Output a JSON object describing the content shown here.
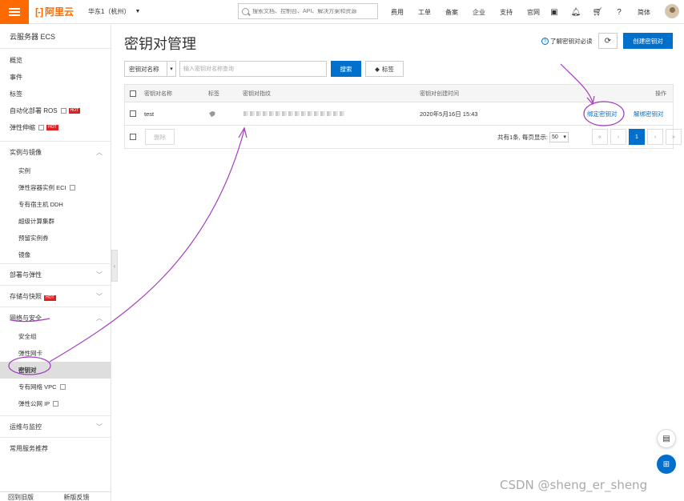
{
  "topbar": {
    "brand": "阿里云",
    "region": "华东1（杭州）",
    "search_placeholder": "搜索文档、控制台、API、解决方案和资源",
    "nav": [
      "费用",
      "工单",
      "备案",
      "企业",
      "支持",
      "官网"
    ],
    "lang": "简体"
  },
  "sidebar": {
    "title": "云服务器 ECS",
    "top_items": [
      "概览",
      "事件",
      "标签",
      "自动化部署 ROS",
      "弹性伸缩"
    ],
    "hot_label": "HOT",
    "groups": {
      "instances": {
        "label": "实例与镜像",
        "items": [
          "实例",
          "弹性容器实例 ECI",
          "专有宿主机 DDH",
          "超级计算集群",
          "预留实例券",
          "镜像"
        ]
      },
      "deploy": "部署与弹性",
      "storage": "存储与快照",
      "network": {
        "label": "网络与安全",
        "items": [
          "安全组",
          "弹性网卡",
          "密钥对",
          "专有网络 VPC",
          "弹性公网 IP"
        ]
      },
      "ops": "运维与监控",
      "common": "常用服务推荐"
    },
    "bottom": [
      "回到旧版",
      "新版反馈"
    ]
  },
  "main": {
    "title": "密钥对管理",
    "help_link": "了解密钥对必读",
    "create_button": "创建密钥对",
    "filter_select": "密钥对名称",
    "filter_placeholder": "输入密钥对名称查询",
    "search_button": "搜索",
    "tag_button": "标签",
    "columns": [
      "密钥对名称",
      "标签",
      "密钥对指纹",
      "密钥对创建时间",
      "操作"
    ],
    "rows": [
      {
        "name": "test",
        "created": "2020年5月16日 15:43",
        "action_bind": "绑定密钥对",
        "action_unbind": "解绑密钥对"
      }
    ],
    "delete_button": "删除",
    "pager_text": "共有1条, 每页显示:",
    "page_size": "50",
    "pages": [
      "«",
      "‹",
      "1",
      "›",
      "»"
    ]
  },
  "watermark": "CSDN @sheng_er_sheng",
  "colors": {
    "accent": "#0070cc",
    "brand": "#ff6a00",
    "annotation": "#a43bbd"
  }
}
